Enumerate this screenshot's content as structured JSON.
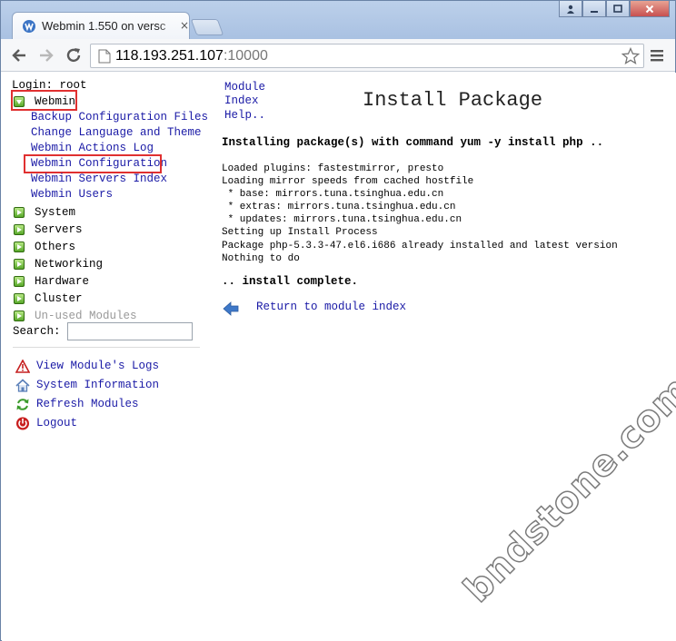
{
  "browser": {
    "tab_title": "Webmin 1.550 on versc",
    "url_host": "118.193.251.107",
    "url_port": ":10000"
  },
  "sidebar": {
    "login": "Login: root",
    "categories": [
      {
        "label": "Webmin",
        "open": true
      },
      {
        "label": "System"
      },
      {
        "label": "Servers"
      },
      {
        "label": "Others"
      },
      {
        "label": "Networking"
      },
      {
        "label": "Hardware"
      },
      {
        "label": "Cluster"
      },
      {
        "label": "Un-used Modules"
      }
    ],
    "webmin_items": [
      "Backup Configuration Files",
      "Change Language and Theme",
      "Webmin Actions Log",
      "Webmin Configuration",
      "Webmin Servers Index",
      "Webmin Users"
    ],
    "search_label": "Search:",
    "search_value": "",
    "tools": [
      {
        "label": "View Module's Logs",
        "icon": "warning-icon"
      },
      {
        "label": "System Information",
        "icon": "home-icon"
      },
      {
        "label": "Refresh Modules",
        "icon": "refresh-icon"
      },
      {
        "label": "Logout",
        "icon": "power-icon"
      }
    ]
  },
  "main": {
    "help_links": [
      "Module",
      "Index",
      "Help.."
    ],
    "title": "Install Package",
    "command_line": "Installing package(s) with command yum -y install php ..",
    "output_lines": [
      "Loaded plugins: fastestmirror, presto",
      "Loading mirror speeds from cached hostfile",
      " * base: mirrors.tuna.tsinghua.edu.cn",
      " * extras: mirrors.tuna.tsinghua.edu.cn",
      " * updates: mirrors.tuna.tsinghua.edu.cn",
      "Setting up Install Process",
      "Package php-5.3.3-47.el6.i686 already installed and latest version",
      "Nothing to do"
    ],
    "complete_text": ".. install complete.",
    "return_link": "Return to module index"
  },
  "watermark": "bndstone.com",
  "colors": {
    "link": "#1a1aa6",
    "highlight": "#e03030",
    "category_icon": "#58a82a"
  }
}
